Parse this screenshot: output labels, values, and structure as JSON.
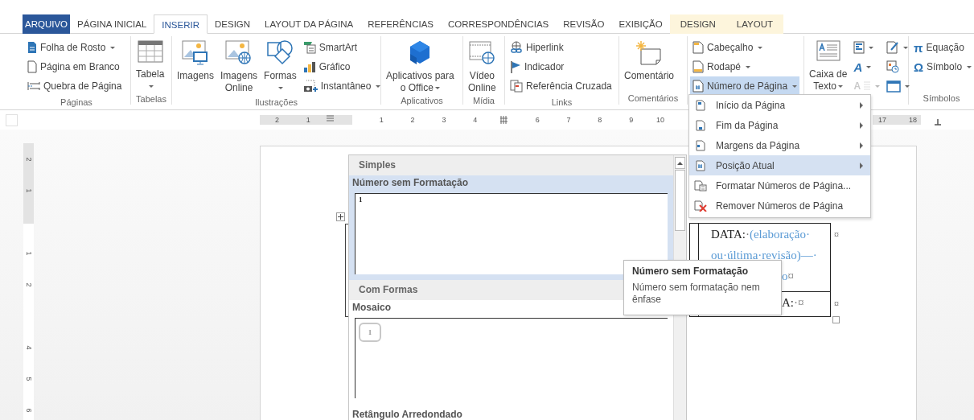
{
  "tabs": [
    {
      "label": "ARQUIVO",
      "kind": "file",
      "selected": false
    },
    {
      "label": "PÁGINA INICIAL",
      "kind": "normal",
      "selected": false
    },
    {
      "label": "INSERIR",
      "kind": "normal",
      "selected": true
    },
    {
      "label": "DESIGN",
      "kind": "normal",
      "selected": false
    },
    {
      "label": "LAYOUT DA PÁGINA",
      "kind": "normal",
      "selected": false
    },
    {
      "label": "REFERÊNCIAS",
      "kind": "normal",
      "selected": false
    },
    {
      "label": "CORRESPONDÊNCIAS",
      "kind": "normal",
      "selected": false
    },
    {
      "label": "REVISÃO",
      "kind": "normal",
      "selected": false
    },
    {
      "label": "EXIBIÇÃO",
      "kind": "normal",
      "selected": false
    },
    {
      "label": "DESIGN",
      "kind": "contextual",
      "selected": false
    },
    {
      "label": "LAYOUT",
      "kind": "contextual",
      "selected": false
    }
  ],
  "ribbon": {
    "groups": [
      {
        "label": "Páginas",
        "columns": [
          {
            "kind": "stack",
            "items": [
              {
                "label": "Folha de Rosto",
                "dropdown": true,
                "pressed": false
              },
              {
                "label": "Página em Branco",
                "dropdown": false,
                "pressed": false
              },
              {
                "label": "Quebra de Página",
                "dropdown": false,
                "pressed": false
              }
            ]
          }
        ]
      },
      {
        "label": "Tabelas",
        "columns": [
          {
            "kind": "large",
            "items": [
              {
                "lines": [
                  "Tabela"
                ],
                "dropdown": true,
                "pressed": false
              }
            ]
          }
        ]
      },
      {
        "label": "Ilustrações",
        "columns": [
          {
            "kind": "large",
            "items": [
              {
                "lines": [
                  "Imagens"
                ],
                "dropdown": false,
                "pressed": false
              }
            ]
          },
          {
            "kind": "large",
            "items": [
              {
                "lines": [
                  "Imagens",
                  "Online"
                ],
                "dropdown": false,
                "pressed": false
              }
            ]
          },
          {
            "kind": "large",
            "items": [
              {
                "lines": [
                  "Formas"
                ],
                "dropdown": true,
                "pressed": false
              }
            ]
          },
          {
            "kind": "stack",
            "items": [
              {
                "label": "SmartArt",
                "dropdown": false,
                "pressed": false
              },
              {
                "label": "Gráfico",
                "dropdown": false,
                "pressed": false
              },
              {
                "label": "Instantâneo",
                "dropdown": true,
                "pressed": false
              }
            ]
          }
        ]
      },
      {
        "label": "Aplicativos",
        "columns": [
          {
            "kind": "large",
            "items": [
              {
                "lines": [
                  "Aplicativos para",
                  "o Office"
                ],
                "dropdown": true,
                "pressed": false
              }
            ]
          }
        ]
      },
      {
        "label": "Mídia",
        "columns": [
          {
            "kind": "large",
            "items": [
              {
                "lines": [
                  "Vídeo",
                  "Online"
                ],
                "dropdown": false,
                "pressed": false
              }
            ]
          }
        ]
      },
      {
        "label": "Links",
        "columns": [
          {
            "kind": "stack",
            "items": [
              {
                "label": "Hiperlink",
                "dropdown": false,
                "pressed": false
              },
              {
                "label": "Indicador",
                "dropdown": false,
                "pressed": false
              },
              {
                "label": "Referência Cruzada",
                "dropdown": false,
                "pressed": false
              }
            ]
          }
        ]
      },
      {
        "label": "Comentários",
        "columns": [
          {
            "kind": "large",
            "items": [
              {
                "lines": [
                  "Comentário"
                ],
                "dropdown": false,
                "pressed": false
              }
            ]
          }
        ]
      },
      {
        "columns": [
          {
            "kind": "stack",
            "items": [
              {
                "label": "Cabeçalho",
                "dropdown": true,
                "pressed": false
              },
              {
                "label": "Rodapé",
                "dropdown": true,
                "pressed": false
              },
              {
                "label": "Número de Página",
                "dropdown": true,
                "pressed": true
              }
            ]
          }
        ]
      },
      {
        "columns": [
          {
            "kind": "large",
            "items": [
              {
                "lines": [
                  "Caixa de",
                  "Texto"
                ],
                "dropdown": true,
                "pressed": false
              }
            ]
          },
          {
            "kind": "stack",
            "items": [
              {
                "dropdown": true,
                "disabled": false
              },
              {
                "glyph": "A",
                "dropdown": true,
                "disabled": false
              },
              {
                "glyph": "A",
                "dropdown": true,
                "disabled": true
              }
            ]
          },
          {
            "kind": "stack",
            "items": [
              {
                "dropdown": true,
                "disabled": false
              },
              {
                "dropdown": false,
                "disabled": false
              },
              {
                "dropdown": true,
                "disabled": false
              }
            ]
          }
        ]
      },
      {
        "label": "Símbolos",
        "columns": [
          {
            "kind": "stack",
            "items": [
              {
                "glyph": "π",
                "label": "Equação",
                "dropdown": false,
                "pressed": false
              },
              {
                "glyph": "Ω",
                "label": "Símbolo",
                "dropdown": true,
                "pressed": false
              }
            ]
          }
        ]
      }
    ]
  },
  "ruler": {
    "left_labels": [
      "2",
      "1"
    ],
    "body_labels": [
      "1",
      "2",
      "3",
      "4"
    ],
    "body_labels_after_marker": [
      "6",
      "7",
      "8",
      "9",
      "10"
    ],
    "right_labels": [
      "17",
      "18"
    ]
  },
  "vertical_ruler": {
    "top_labels": [
      "2",
      "1"
    ],
    "body_labels": [
      "1",
      "2"
    ],
    "lower_labels": [
      "4",
      "5",
      "6"
    ]
  },
  "gallery": {
    "sections": [
      {
        "title": "Simples",
        "items": [
          {
            "label": "Número sem Formatação",
            "selected": true,
            "kind": "plain",
            "preview_text": "1"
          }
        ]
      },
      {
        "title": "Com Formas",
        "items": [
          {
            "label": "Mosaico",
            "selected": false,
            "kind": "mosaic",
            "preview_text": "1"
          },
          {
            "label": "Retângulo Arredondado",
            "selected": false,
            "kind": "cut"
          }
        ]
      }
    ]
  },
  "menu": {
    "items": [
      {
        "label": "Início da Página",
        "submenu": true,
        "selected": false
      },
      {
        "label": "Fim da Página",
        "submenu": true,
        "selected": false
      },
      {
        "label": "Margens da Página",
        "submenu": true,
        "selected": false
      },
      {
        "label": "Posição Atual",
        "submenu": true,
        "selected": true
      },
      {
        "label": "Formatar Números de Página...",
        "submenu": false,
        "selected": false
      },
      {
        "label": "Remover Números de Página",
        "submenu": false,
        "selected": false
      }
    ]
  },
  "tooltip": {
    "title": "Número sem Formatação",
    "text": "Número sem formatação nem ênfase"
  },
  "document_table": {
    "rows": [
      {
        "lines": [
          {
            "partial": false,
            "runs": [
              {
                "text": "DATA:",
                "kind": "plain"
              },
              {
                "text": "·",
                "kind": "mark"
              },
              {
                "text": "(elaboração·",
                "kind": "field"
              }
            ]
          },
          {
            "partial": false,
            "runs": [
              {
                "text": "ou·última·revisão)—·",
                "kind": "field"
              }
            ]
          },
          {
            "partial": true,
            "runs": [
              {
                "text": "o",
                "kind": "field"
              },
              {
                "text": "¤",
                "kind": "mark"
              }
            ]
          }
        ],
        "end_mark": "¤"
      },
      {
        "lines": [
          {
            "partial": true,
            "runs": [
              {
                "text": "A:",
                "kind": "plain"
              },
              {
                "text": "·¤",
                "kind": "mark"
              }
            ]
          }
        ],
        "end_mark": "¤"
      }
    ]
  }
}
